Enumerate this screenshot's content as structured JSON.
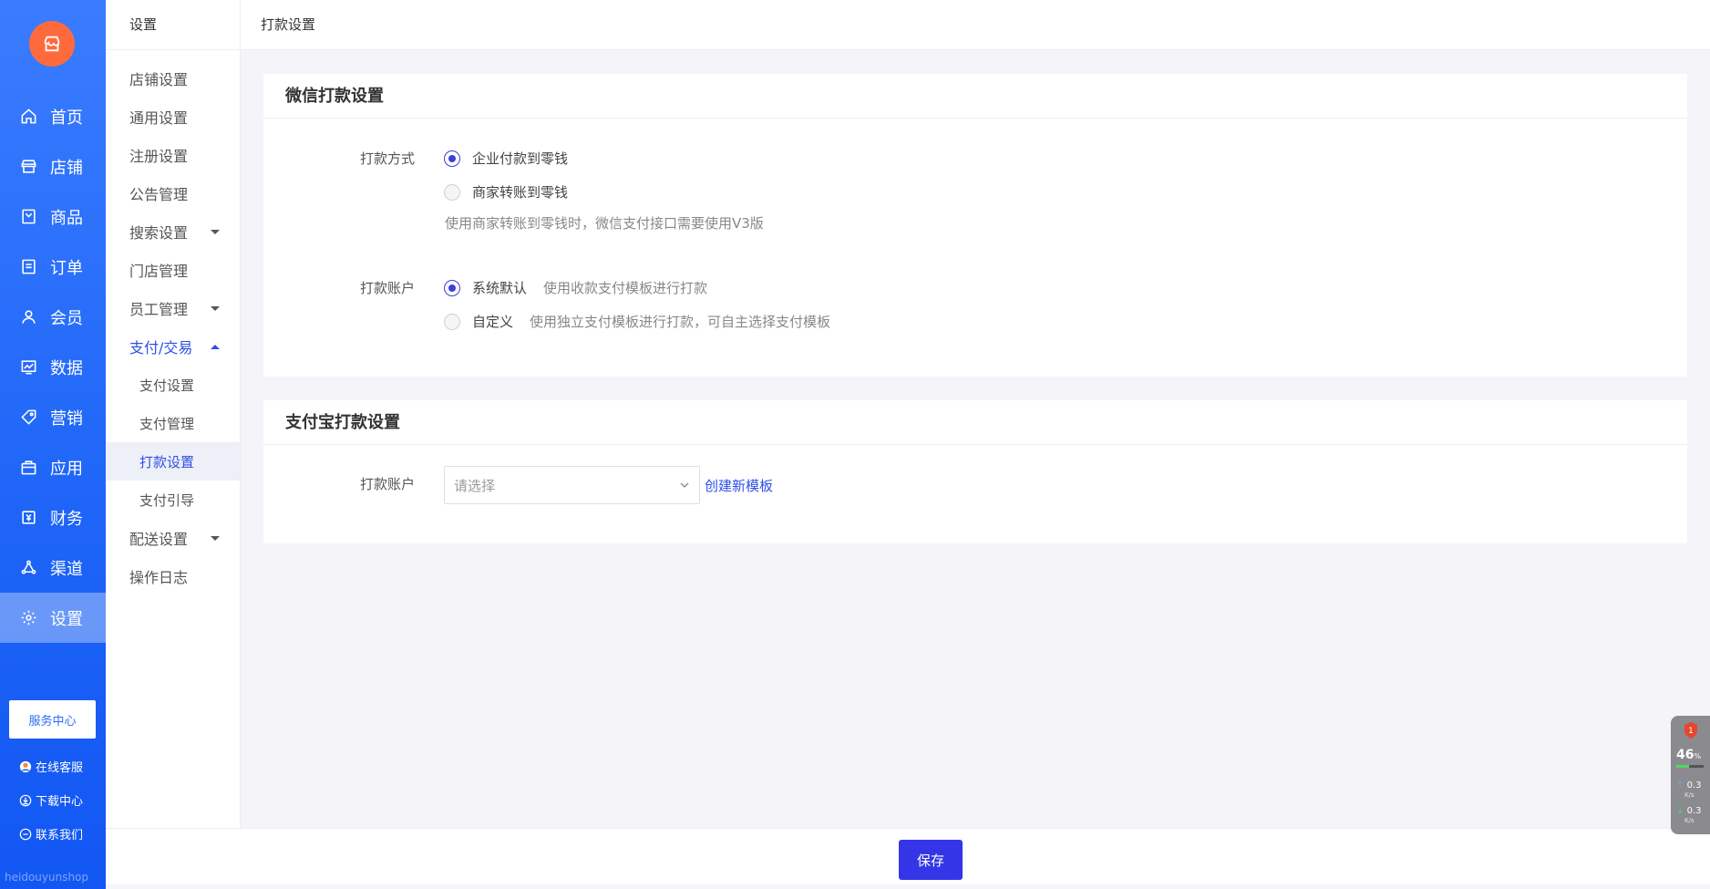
{
  "sidebar": {
    "items": [
      {
        "label": "首页",
        "icon": "home-icon"
      },
      {
        "label": "店铺",
        "icon": "store-icon"
      },
      {
        "label": "商品",
        "icon": "goods-icon"
      },
      {
        "label": "订单",
        "icon": "order-icon"
      },
      {
        "label": "会员",
        "icon": "member-icon"
      },
      {
        "label": "数据",
        "icon": "data-icon"
      },
      {
        "label": "营销",
        "icon": "marketing-icon"
      },
      {
        "label": "应用",
        "icon": "app-icon"
      },
      {
        "label": "财务",
        "icon": "finance-icon"
      },
      {
        "label": "渠道",
        "icon": "channel-icon"
      },
      {
        "label": "设置",
        "icon": "settings-icon"
      }
    ],
    "active_index": 10,
    "service_button": "服务中心",
    "links": {
      "online_service": "在线客服",
      "download_center": "下载中心",
      "contact_us": "联系我们"
    },
    "brand_mark": "heidouyunshop"
  },
  "subnav": {
    "title": "设置",
    "items": {
      "shop": "店铺设置",
      "general": "通用设置",
      "register": "注册设置",
      "notice": "公告管理",
      "search": "搜索设置",
      "stores": "门店管理",
      "staff": "员工管理",
      "payment": "支付/交易",
      "payment_children": [
        "支付设置",
        "支付管理",
        "打款设置",
        "支付引导"
      ],
      "delivery": "配送设置",
      "log": "操作日志"
    },
    "active_child_index": 2
  },
  "header": {
    "title": "打款设置"
  },
  "wechat": {
    "title": "微信打款设置",
    "method_label": "打款方式",
    "method_options": [
      "企业付款到零钱",
      "商家转账到零钱"
    ],
    "method_hint": "使用商家转账到零钱时，微信支付接口需要使用V3版",
    "account_label": "打款账户",
    "account_options": [
      {
        "label": "系统默认",
        "desc": "使用收款支付模板进行打款"
      },
      {
        "label": "自定义",
        "desc": "使用独立支付模板进行打款，可自主选择支付模板"
      }
    ]
  },
  "alipay": {
    "title": "支付宝打款设置",
    "account_label": "打款账户",
    "select_placeholder": "请选择",
    "create_link": "创建新模板"
  },
  "footer": {
    "save_label": "保存"
  },
  "widget": {
    "badge": "1",
    "percent": "46",
    "percent_unit": "%",
    "up_speed": "0.3",
    "down_speed": "0.3",
    "speed_unit": "K/s"
  },
  "colors": {
    "primary": "#3535e8",
    "sidebar": "#1d64f7",
    "link": "#2d50e6",
    "logo": "#ff6a3d"
  }
}
